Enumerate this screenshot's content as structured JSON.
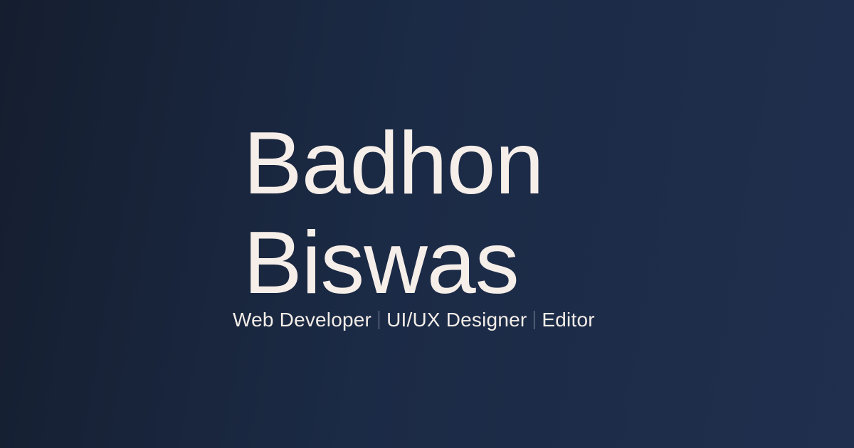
{
  "title": {
    "line1": "Badhon",
    "line2": "Biswas"
  },
  "tagline": {
    "role1": "Web Developer",
    "role2": "UI/UX Designer",
    "role3": "Editor"
  },
  "colors": {
    "background_left": "#151e2f",
    "background_right": "#1f2f4d",
    "text": "#f6eee9",
    "separator": "#8b96a8"
  }
}
